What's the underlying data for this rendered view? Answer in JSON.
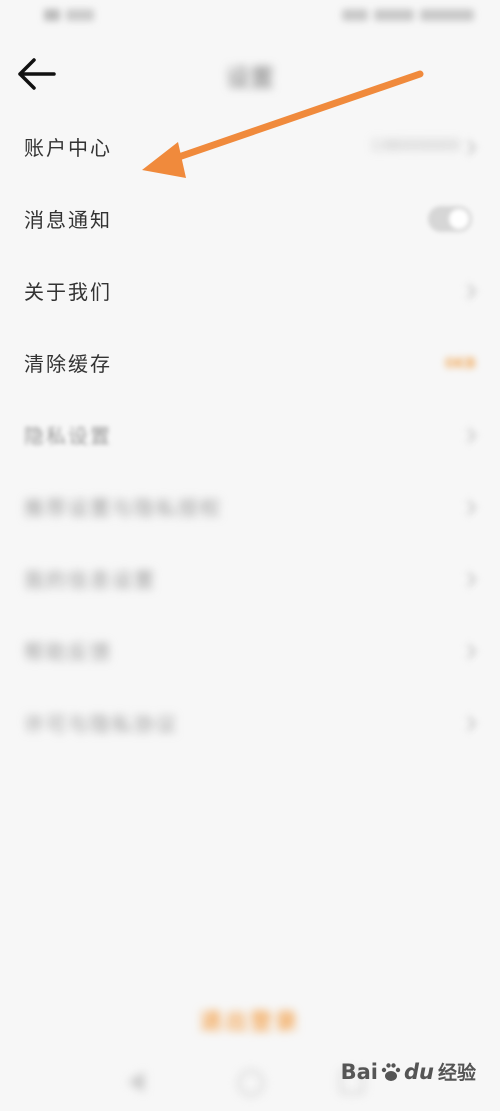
{
  "header": {
    "title": "设置"
  },
  "settings": {
    "account": {
      "label": "账户中心",
      "value": "1380000000"
    },
    "notifications": {
      "label": "消息通知"
    },
    "about": {
      "label": "关于我们"
    },
    "cache": {
      "label": "清除缓存",
      "value": "0KB"
    },
    "privacy": {
      "label": "隐私设置"
    },
    "recommend": {
      "label": "推荐设置与隐私授权"
    },
    "personal": {
      "label": "我的信息设置"
    },
    "help": {
      "label": "帮助反馈"
    },
    "terms": {
      "label": "许可与隐私协议"
    }
  },
  "logout": {
    "label": "退出登录"
  },
  "watermark": {
    "brand_a": "Bai",
    "brand_b": "du",
    "brand_c": "经验"
  },
  "icons": {
    "back": "arrow-left-icon",
    "chevron": "chevron-right-icon",
    "toggle": "toggle-switch",
    "arrow": "orange-annotation-arrow"
  },
  "colors": {
    "accent": "#f08a3c",
    "cache": "#f0b06a"
  }
}
